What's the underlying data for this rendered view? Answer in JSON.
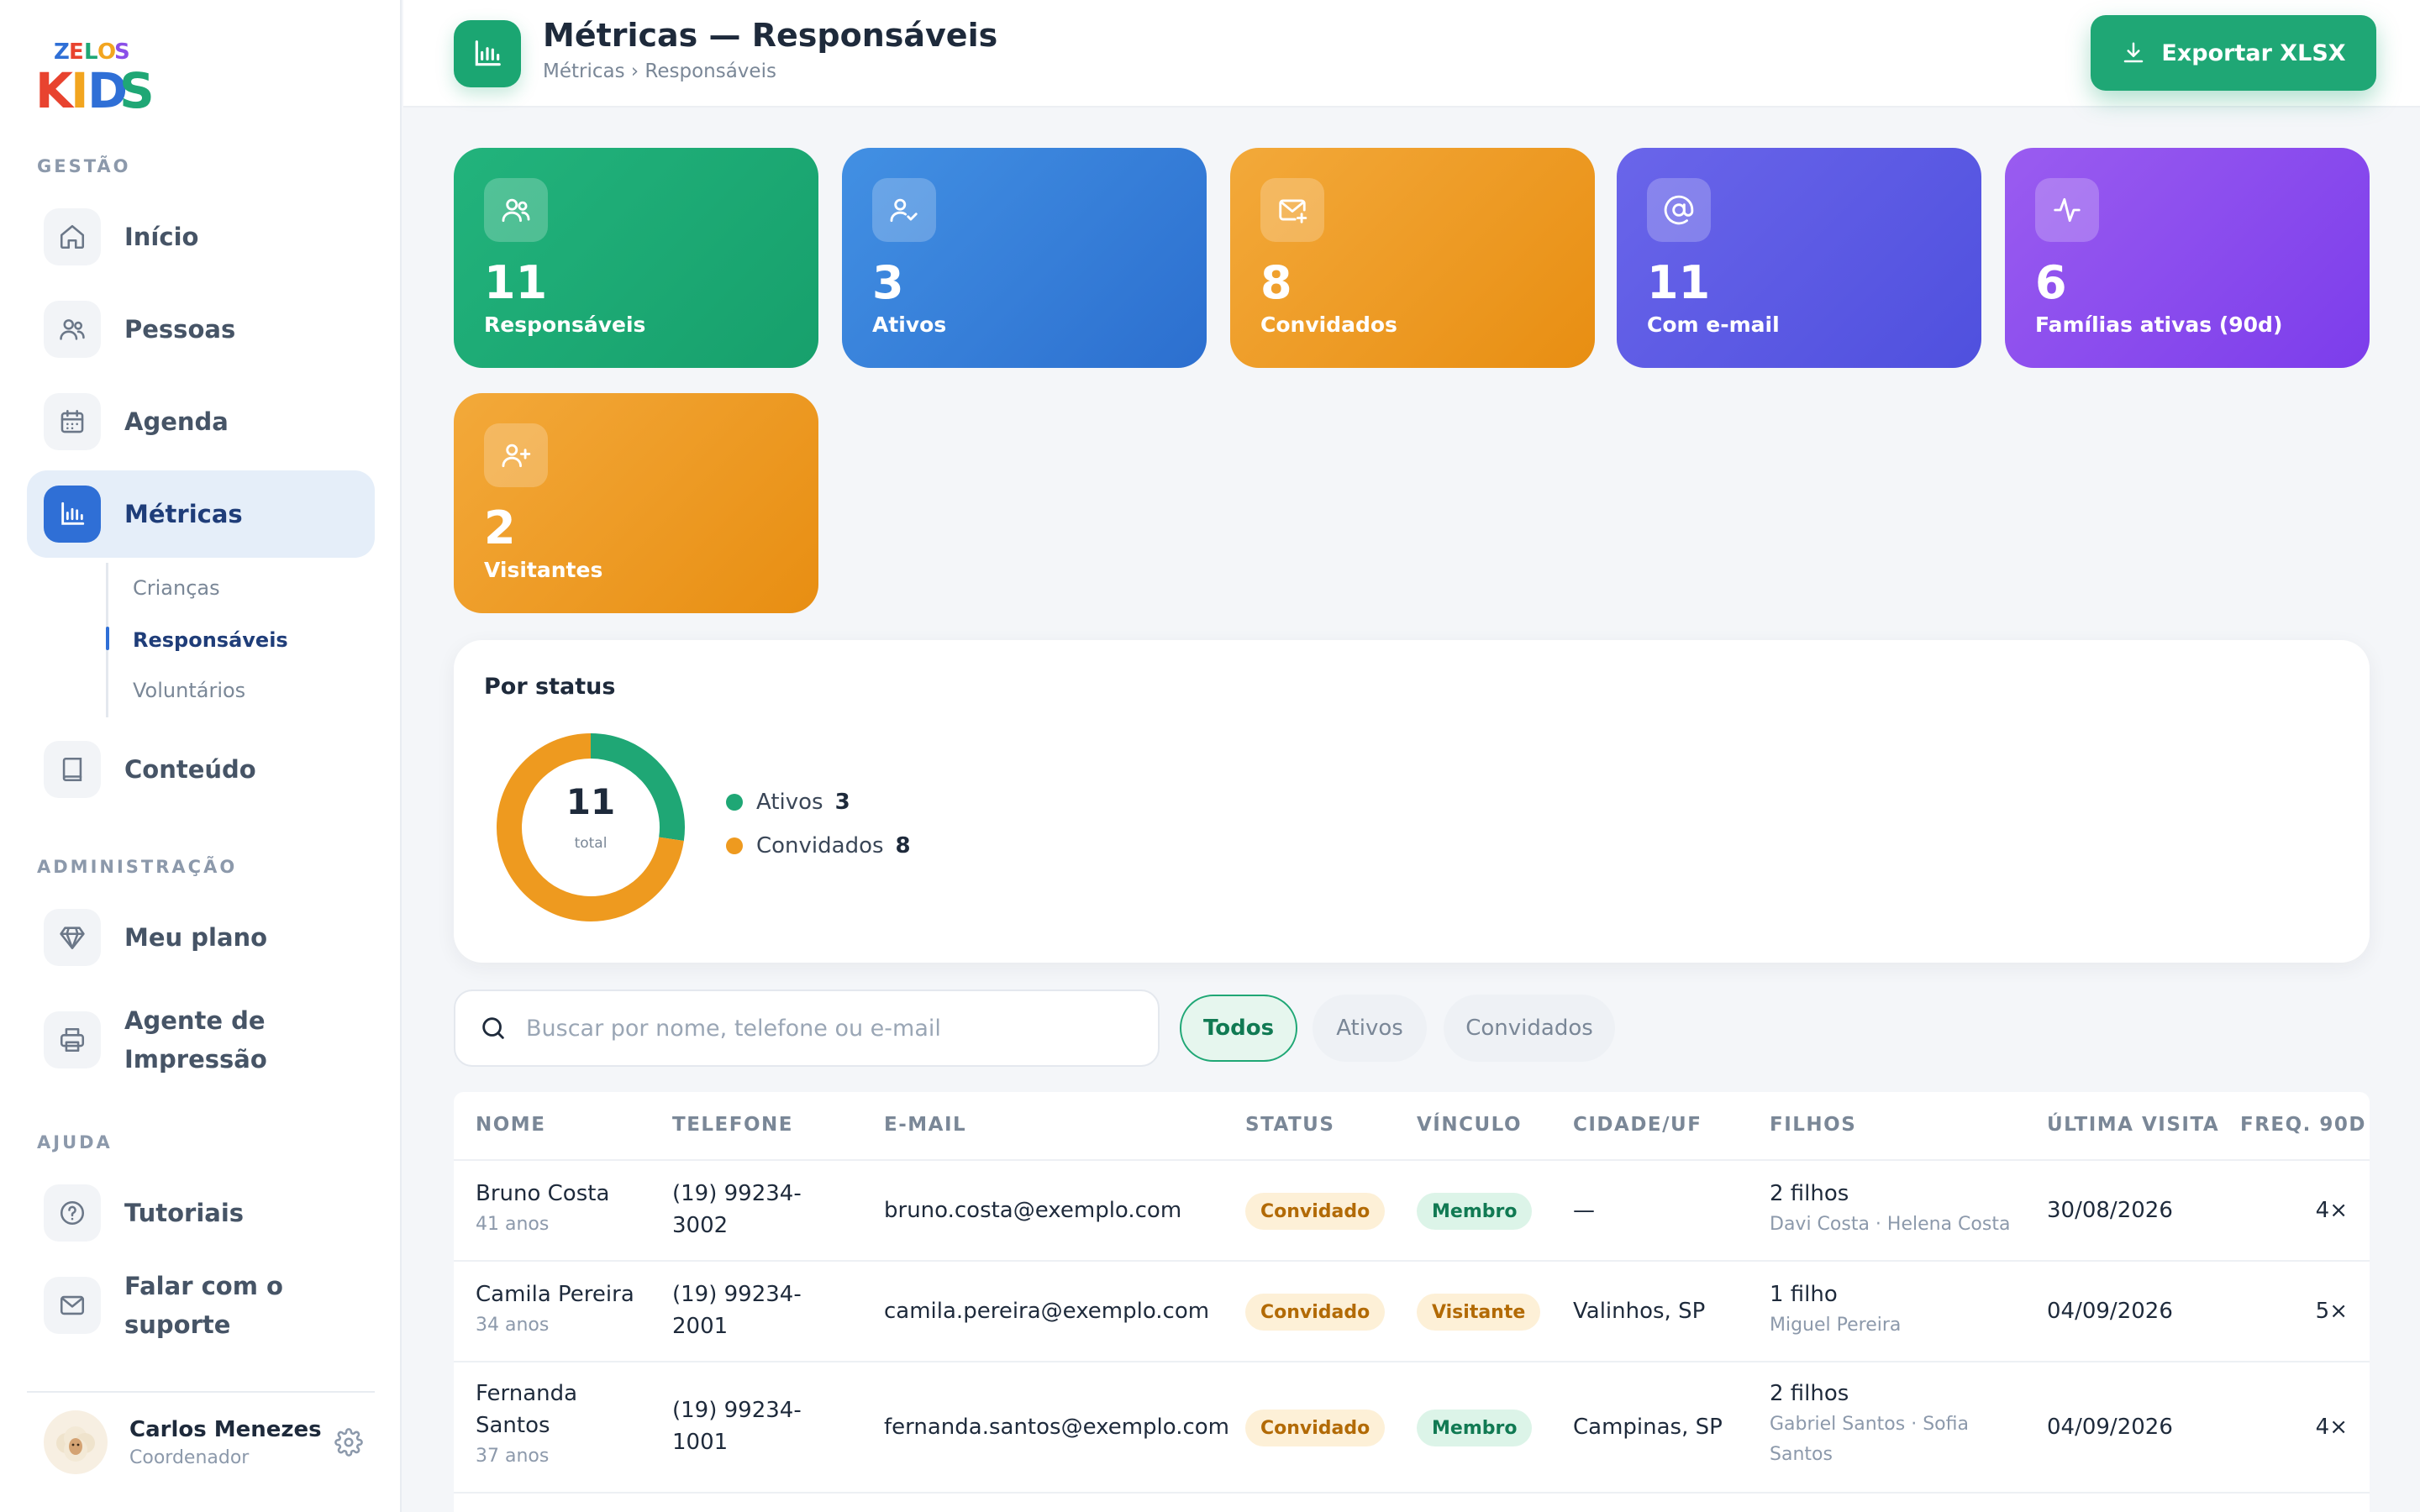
{
  "brand": {
    "line1": "ZELOS",
    "line2": "KIDS"
  },
  "sidebar": {
    "sections": {
      "gestao": "GESTÃO",
      "admin": "ADMINISTRAÇÃO",
      "ajuda": "AJUDA"
    },
    "items": {
      "inicio": "Início",
      "pessoas": "Pessoas",
      "agenda": "Agenda",
      "metricas": "Métricas",
      "conteudo": "Conteúdo",
      "plano": "Meu plano",
      "agente1": "Agente de",
      "agente2": "Impressão",
      "tutoriais": "Tutoriais",
      "suporte": "Falar com o suporte"
    },
    "subitems": {
      "criancas": "Crianças",
      "responsaveis": "Responsáveis",
      "voluntarios": "Voluntários"
    },
    "active": "metricas",
    "user": {
      "name": "Carlos Menezes",
      "role": "Coordenador"
    }
  },
  "header": {
    "title": "Métricas — Responsáveis",
    "breadcrumb": "Métricas › Responsáveis",
    "export_label": "Exportar XLSX"
  },
  "cards": [
    {
      "value": "11",
      "label": "Responsáveis",
      "icon": "users-icon"
    },
    {
      "value": "3",
      "label": "Ativos",
      "icon": "user-check-icon"
    },
    {
      "value": "8",
      "label": "Convidados",
      "icon": "mail-plus-icon"
    },
    {
      "value": "11",
      "label": "Com e-mail",
      "icon": "at-sign-icon"
    },
    {
      "value": "6",
      "label": "Famílias ativas (90d)",
      "icon": "activity-icon"
    },
    {
      "value": "2",
      "label": "Visitantes",
      "icon": "user-plus-icon"
    }
  ],
  "status_panel": {
    "title": "Por status",
    "total": "11",
    "total_label": "total",
    "legend": [
      {
        "label": "Ativos",
        "value": "3",
        "color": "#1fa775"
      },
      {
        "label": "Convidados",
        "value": "8",
        "color": "#ee9a1f"
      }
    ]
  },
  "chart_data": {
    "type": "pie",
    "categories": [
      "Ativos",
      "Convidados"
    ],
    "values": [
      3,
      8
    ],
    "colors": [
      "#1fa775",
      "#ee9a1f"
    ]
  },
  "search": {
    "placeholder": "Buscar por nome, telefone ou e-mail"
  },
  "filters": [
    "Todos",
    "Ativos",
    "Convidados"
  ],
  "table": {
    "columns": [
      "NOME",
      "TELEFONE",
      "E-MAIL",
      "STATUS",
      "VÍNCULO",
      "CIDADE/UF",
      "FILHOS",
      "ÚLTIMA VISITA",
      "FREQ. 90D"
    ],
    "rows": [
      {
        "name1": "Bruno Costa",
        "name2": "",
        "age": "41 anos",
        "phone1": "(19) 99234-",
        "phone2": "3002",
        "email": "bruno.costa@exemplo.com",
        "status": "Convidado",
        "link": "Membro",
        "city": "—",
        "kids": "2 filhos",
        "kids_names1": "Davi Costa · Helena Costa",
        "kids_names2": "",
        "last": "30/08/2026",
        "freq": "4×"
      },
      {
        "name1": "Camila Pereira",
        "name2": "",
        "age": "34 anos",
        "phone1": "(19) 99234-",
        "phone2": "2001",
        "email": "camila.pereira@exemplo.com",
        "status": "Convidado",
        "link": "Visitante",
        "city": "Valinhos, SP",
        "kids": "1 filho",
        "kids_names1": "Miguel Pereira",
        "kids_names2": "",
        "last": "04/09/2026",
        "freq": "5×"
      },
      {
        "name1": "Fernanda",
        "name2": "Santos",
        "age": "37 anos",
        "phone1": "(19) 99234-",
        "phone2": "1001",
        "email": "fernanda.santos@exemplo.com",
        "status": "Convidado",
        "link": "Membro",
        "city": "Campinas, SP",
        "kids": "2 filhos",
        "kids_names1": "Gabriel Santos · Sofia",
        "kids_names2": "Santos",
        "last": "04/09/2026",
        "freq": "4×"
      }
    ]
  }
}
